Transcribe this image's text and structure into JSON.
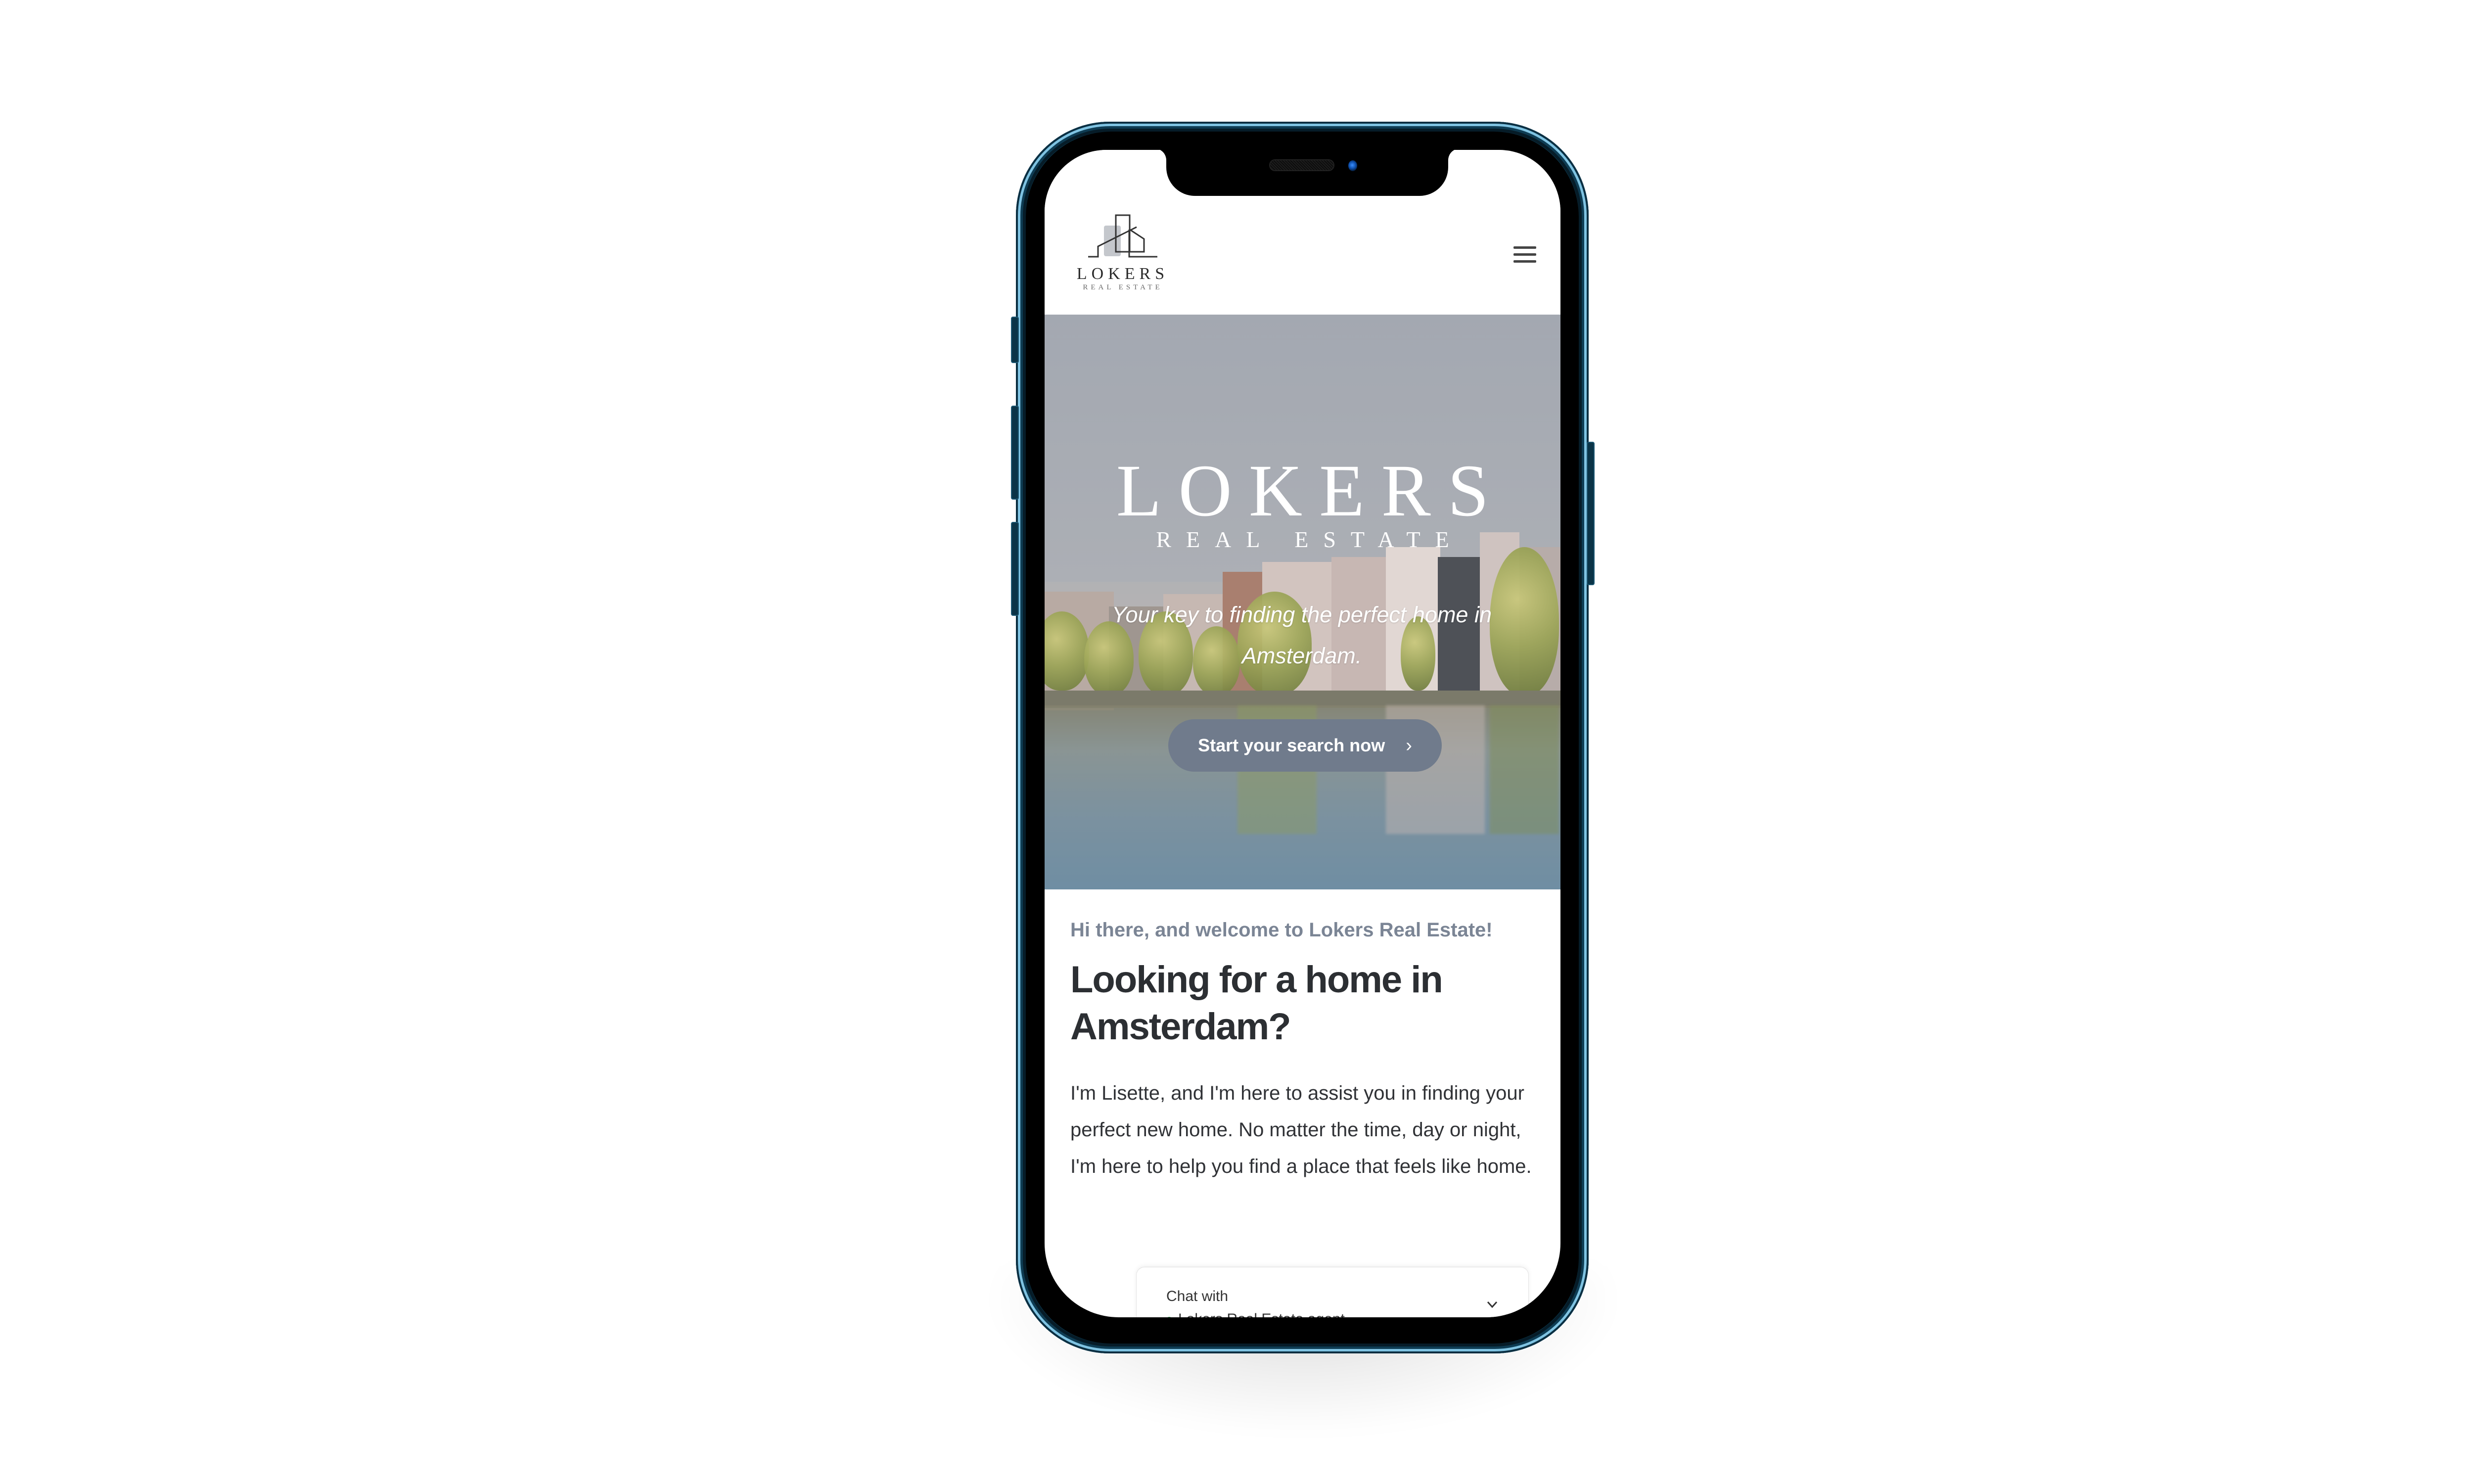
{
  "header": {
    "logo": {
      "name": "LOKERS",
      "subtitle": "REAL ESTATE",
      "icon": "building-outline-logo"
    },
    "menu_icon": "hamburger-menu-icon"
  },
  "hero": {
    "title": "LOKERS",
    "subtitle": "REAL ESTATE",
    "tagline": "Your key to finding the perfect home in Amsterdam.",
    "cta": {
      "label": "Start your search now",
      "icon": "chevron-right-icon",
      "color": "#707b8c"
    }
  },
  "intro": {
    "greeting": "Hi there, and welcome to Lokers Real Estate!",
    "heading": "Looking for a home in Amsterdam?",
    "body": "I'm Lisette, and I'm here to assist you in finding your perfect new home. No matter the time, day or night, I'm here to help you find a place that feels like home."
  },
  "chat_widget": {
    "label": "Chat with",
    "agent": "Lokers Real Estate agent",
    "status_color": "#42b35c",
    "toggle_icon": "chevron-down-icon"
  },
  "device": {
    "frame_color": "#0c3a50"
  }
}
